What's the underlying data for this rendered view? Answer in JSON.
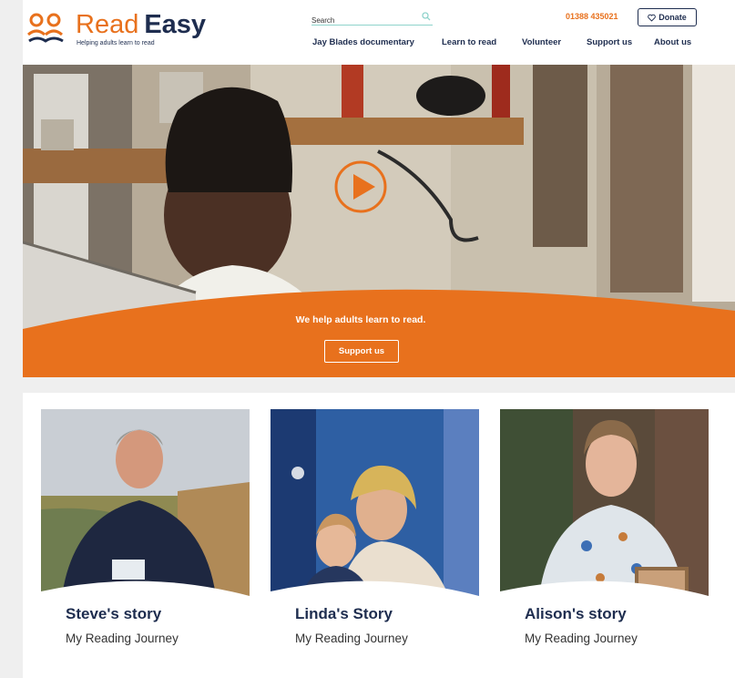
{
  "brand": {
    "name_read": "Read",
    "name_easy": "Easy",
    "tagline": "Helping adults learn to read",
    "orange": "#e8711d",
    "navy": "#1e2d4f"
  },
  "header": {
    "search_placeholder": "Search",
    "phone": "01388 435021",
    "donate_label": "Donate"
  },
  "nav": [
    {
      "label": "Jay Blades documentary"
    },
    {
      "label": "Learn to read"
    },
    {
      "label": "Volunteer"
    },
    {
      "label": "Support us"
    },
    {
      "label": "About us"
    }
  ],
  "hero": {
    "tagline": "We help adults learn to read.",
    "button_label": "Support us"
  },
  "stories": [
    {
      "title": "Steve's story",
      "subtitle": "My Reading Journey"
    },
    {
      "title": "Linda's Story",
      "subtitle": "My Reading Journey"
    },
    {
      "title": "Alison's story",
      "subtitle": "My Reading Journey"
    }
  ]
}
